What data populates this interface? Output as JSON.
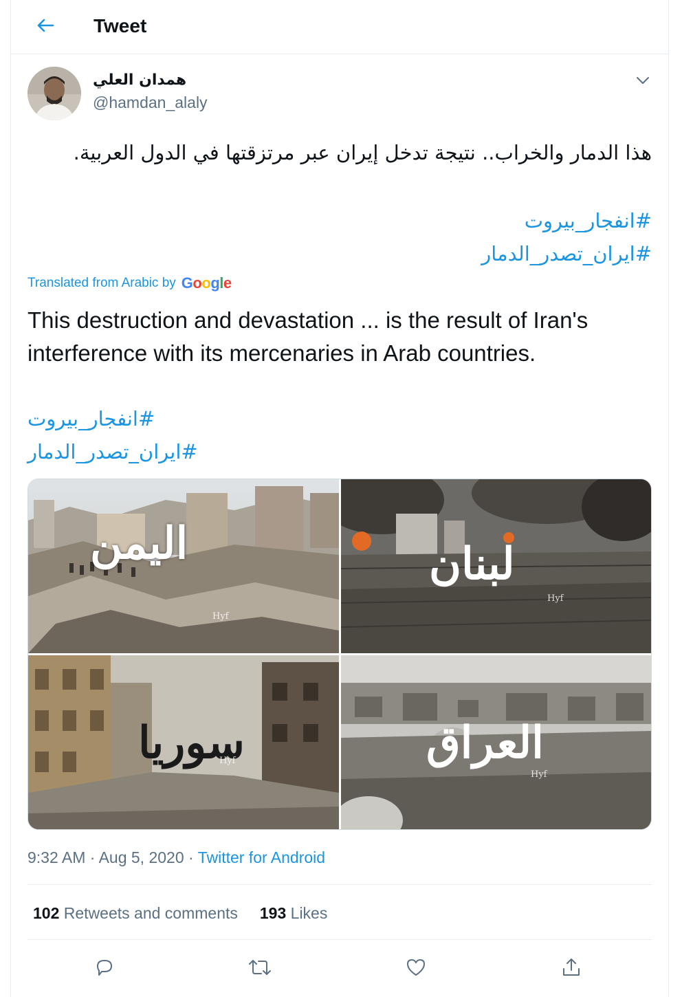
{
  "header": {
    "title": "Tweet"
  },
  "author": {
    "name": "همدان العلي",
    "handle": "@hamdan_alaly"
  },
  "tweet": {
    "arabic_text": "هذا الدمار والخراب.. نتيجة تدخل إيران عبر مرتزقتها في الدول العربية.",
    "hashtags": [
      "#انفجار_بيروت",
      "#ايران_تصدر_الدمار"
    ],
    "translated_label": "Translated from Arabic by",
    "translator": "Google",
    "translation": "This destruction and devastation ... is the result of Iran's interference with its mercenaries in Arab countries."
  },
  "media": {
    "tiles": [
      {
        "label": "اليمن",
        "watermark": "Hyf"
      },
      {
        "label": "لبنان",
        "watermark": "Hyf"
      },
      {
        "label": "سوريا",
        "watermark": "Hyf"
      },
      {
        "label": "العراق",
        "watermark": "Hyf"
      }
    ]
  },
  "meta": {
    "time": "9:32 AM",
    "date": "Aug 5, 2020",
    "separator": "·",
    "source": "Twitter for Android"
  },
  "stats": {
    "retweets_count": "102",
    "retweets_label": "Retweets and comments",
    "likes_count": "193",
    "likes_label": "Likes"
  },
  "colors": {
    "link": "#1b95e0",
    "secondary": "#5b7083",
    "border": "#e6ecf0"
  },
  "icons": [
    "back-arrow-icon",
    "chevron-down-icon",
    "reply-icon",
    "retweet-icon",
    "like-icon",
    "share-icon"
  ]
}
